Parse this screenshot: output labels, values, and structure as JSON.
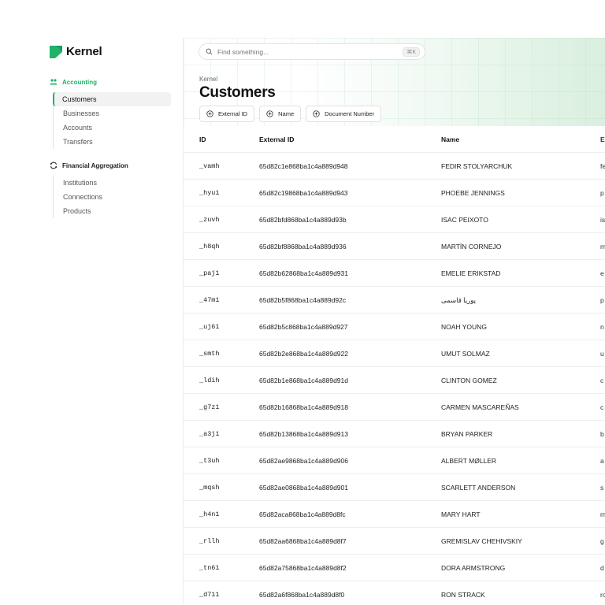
{
  "app": {
    "name": "Kernel",
    "brand_color": "#1fb36a"
  },
  "search": {
    "placeholder": "Find something...",
    "shortcut": "⌘K"
  },
  "sidebar": {
    "sections": [
      {
        "label": "Accounting",
        "icon": "users-icon",
        "items": [
          {
            "label": "Customers",
            "active": true
          },
          {
            "label": "Businesses"
          },
          {
            "label": "Accounts"
          },
          {
            "label": "Transfers"
          }
        ]
      },
      {
        "label": "Financial Aggregation",
        "icon": "sync-icon",
        "items": [
          {
            "label": "Institutions"
          },
          {
            "label": "Connections"
          },
          {
            "label": "Products"
          }
        ]
      }
    ]
  },
  "header": {
    "breadcrumb": "Kernel",
    "title": "Customers"
  },
  "filters": [
    {
      "label": "External ID"
    },
    {
      "label": "Name"
    },
    {
      "label": "Document Number"
    }
  ],
  "table": {
    "columns": [
      "ID",
      "External ID",
      "Name",
      "E"
    ],
    "rows": [
      {
        "id": "_vamh",
        "external_id": "65d82c1e868ba1c4a889d948",
        "name": "FEDIR STOLYARCHUK",
        "email": "fe"
      },
      {
        "id": "_hyu1",
        "external_id": "65d82c19868ba1c4a889d943",
        "name": "PHOEBE JENNINGS",
        "email": "p"
      },
      {
        "id": "_zuvh",
        "external_id": "65d82bfd868ba1c4a889d93b",
        "name": "ISAC PEIXOTO",
        "email": "is"
      },
      {
        "id": "_h8qh",
        "external_id": "65d82bf8868ba1c4a889d936",
        "name": "MARTÍN CORNEJO",
        "email": "m"
      },
      {
        "id": "_paj1",
        "external_id": "65d82b62868ba1c4a889d931",
        "name": "EMELIE ERIKSTAD",
        "email": "e"
      },
      {
        "id": "_47m1",
        "external_id": "65d82b5f868ba1c4a889d92c",
        "name": "پوریا قاسمی",
        "email": "p"
      },
      {
        "id": "_uj61",
        "external_id": "65d82b5c868ba1c4a889d927",
        "name": "NOAH YOUNG",
        "email": "n"
      },
      {
        "id": "_smth",
        "external_id": "65d82b2e868ba1c4a889d922",
        "name": "UMUT SOLMAZ",
        "email": "u"
      },
      {
        "id": "_ldih",
        "external_id": "65d82b1e868ba1c4a889d91d",
        "name": "CLINTON GOMEZ",
        "email": "c"
      },
      {
        "id": "_g7z1",
        "external_id": "65d82b16868ba1c4a889d918",
        "name": "CARMEN MASCAREÑAS",
        "email": "c"
      },
      {
        "id": "_a3j1",
        "external_id": "65d82b13868ba1c4a889d913",
        "name": "BRYAN PARKER",
        "email": "b"
      },
      {
        "id": "_t3uh",
        "external_id": "65d82ae9868ba1c4a889d906",
        "name": "ALBERT MØLLER",
        "email": "a"
      },
      {
        "id": "_mqsh",
        "external_id": "65d82ae0868ba1c4a889d901",
        "name": "SCARLETT ANDERSON",
        "email": "s"
      },
      {
        "id": "_h4n1",
        "external_id": "65d82aca868ba1c4a889d8fc",
        "name": "MARY HART",
        "email": "m"
      },
      {
        "id": "_rllh",
        "external_id": "65d82aa6868ba1c4a889d8f7",
        "name": "GREMISLAV CHEHIVSKIY",
        "email": "g"
      },
      {
        "id": "_tn61",
        "external_id": "65d82a75868ba1c4a889d8f2",
        "name": "DORA ARMSTRONG",
        "email": "d"
      },
      {
        "id": "_d711",
        "external_id": "65d82a6f868ba1c4a889d8f0",
        "name": "RON STRACK",
        "email": "ro"
      }
    ]
  }
}
